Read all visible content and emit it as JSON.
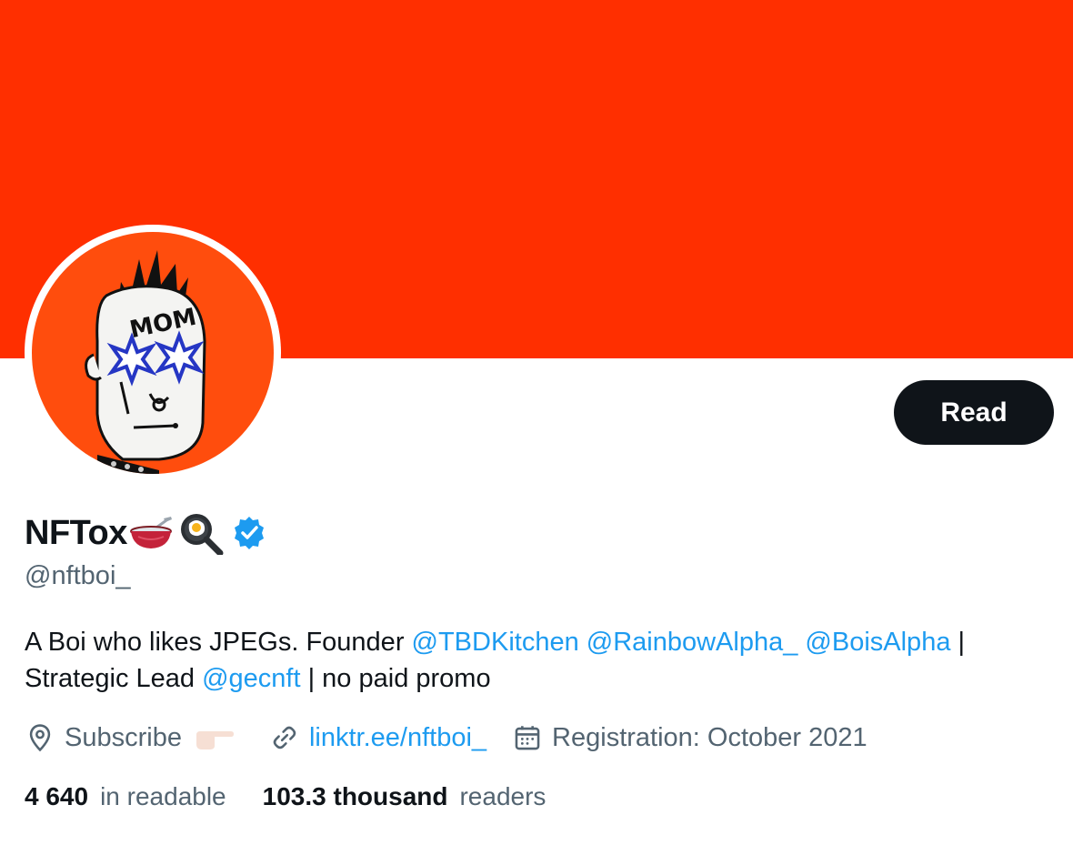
{
  "colors": {
    "banner": "#ff2f00",
    "avatar_bg": "#ff4d0d",
    "accent": "#1d9bf0",
    "text": "#0f1419",
    "muted": "#536471",
    "button": "#0f1419"
  },
  "profile": {
    "display_name": "NFTox",
    "name_emojis": [
      "bowl-with-spoon-emoji",
      "frying-pan-egg-emoji"
    ],
    "verified": true,
    "handle": "@nftboi_",
    "avatar_text": "MOM",
    "read_button_label": "Read"
  },
  "bio": {
    "line1_text": "A Boi who likes JPEGs. Founder ",
    "mentions1": [
      "@TBDKitchen",
      "@RainbowAlpha_",
      "@BoisAlpha"
    ],
    "separator": " |",
    "line2_text": "Strategic Lead ",
    "mention2": "@gecnft",
    "line2_tail": " | no paid promo"
  },
  "meta": {
    "location_icon": "location-pin-icon",
    "location_text": "Subscribe",
    "location_emoji": "pointing-hand-emoji",
    "link_icon": "link-icon",
    "link_text": "linktr.ee/nftboi_",
    "calendar_icon": "calendar-icon",
    "joined_text": "Registration: October 2021"
  },
  "stats": {
    "following_count": "4 640",
    "following_label": "in readable",
    "followers_count": "103.3 thousand",
    "followers_label": "readers"
  }
}
